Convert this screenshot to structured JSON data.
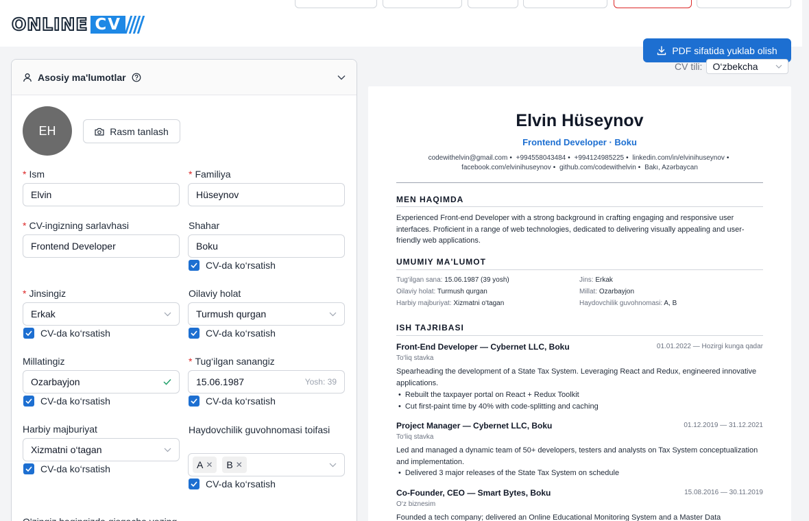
{
  "header": {
    "logo_left": "ONLINE",
    "logo_right": "CV"
  },
  "download_button": "PDF sifatida yuklab olish",
  "cv_language": {
    "label": "CV tili:",
    "value": "O‘zbekcha"
  },
  "form": {
    "section_title": "Asosiy ma'lumotlar",
    "avatar_initials": "EH",
    "photo_button": "Rasm tanlash",
    "show_in_cv": "CV-da ko‘rsatish",
    "first_name": {
      "label": "Ism",
      "value": "Elvin"
    },
    "last_name": {
      "label": "Familiya",
      "value": "Hüseynov"
    },
    "cv_title": {
      "label": "CV-ingizning sarlavhasi",
      "value": "Frontend Developer"
    },
    "city": {
      "label": "Shahar",
      "value": "Boku"
    },
    "gender": {
      "label": "Jinsingiz",
      "value": "Erkak"
    },
    "marital": {
      "label": "Oilaviy holat",
      "value": "Turmush qurgan"
    },
    "nationality": {
      "label": "Millatingiz",
      "value": "Ozarbayjon"
    },
    "birthdate": {
      "label": "Tug‘ilgan sanangiz",
      "value": "15.06.1987",
      "age": "Yosh: 39"
    },
    "military": {
      "label": "Harbiy majburiyat",
      "value": "Xizmatni o‘tagan"
    },
    "license": {
      "label": "Haydovchilik guvohnomasi toifasi",
      "tags": [
        "A",
        "B"
      ]
    },
    "bottom_text": "O'zingiz haqingizda qisqacha yozing"
  },
  "cv": {
    "name": "Elvin Hüseynov",
    "role_line": "Frontend Developer · Boku",
    "contacts": [
      "codewithelvin@gmail.com",
      "+994558043484",
      "+994124985225",
      "linkedin.com/in/elvinihuseynov",
      "facebook.com/elvinihuseynov",
      "github.com/codewithelvin",
      "Bakı, Azərbaycan"
    ],
    "about_title": "MEN HAQIMDA",
    "about_text": "Experienced Front-end Developer with a strong background in crafting engaging and responsive user interfaces. Proficient in a range of web technologies, dedicated to delivering visually appealing and user-friendly web applications.",
    "general_title": "UMUMIY MA'LUMOT",
    "general": [
      {
        "k": "Tug‘ilgan sana:",
        "v": "15.06.1987 (39 yosh)"
      },
      {
        "k": "Jins:",
        "v": "Erkak"
      },
      {
        "k": "Oilaviy holat:",
        "v": "Turmush qurgan"
      },
      {
        "k": "Millat:",
        "v": "Ozarbayjon"
      },
      {
        "k": "Harbiy majburiyat:",
        "v": "Xizmatni o‘tagan"
      },
      {
        "k": "Haydovchilik guvohnomasi:",
        "v": "A, B"
      }
    ],
    "experience_title": "ISH TAJRIBASI",
    "jobs": [
      {
        "title": "Front-End Developer — Cybernet LLC, Boku",
        "date": "01.01.2022 — Hozirgi kunga qadar",
        "type": "To‘liq stavka",
        "desc": "Spearheading the development of a State Tax System. Leveraging React and Redux, engineered innovative applications.",
        "bullets": [
          "Rebuilt the taxpayer portal on React + Redux Toolkit",
          "Cut first-paint time by 40% with code-splitting and caching"
        ]
      },
      {
        "title": "Project Manager — Cybernet LLC, Boku",
        "date": "01.12.2019 — 31.12.2021",
        "type": "To‘liq stavka",
        "desc": "Led and managed a dynamic team of 50+ developers, testers and analysts on Tax System conceptualization and implementation.",
        "bullets": [
          "Delivered 3 major releases of the State Tax System on schedule"
        ]
      },
      {
        "title": "Co-Founder, CEO — Smart Bytes, Boku",
        "date": "15.08.2016 — 30.11.2019",
        "type": "O‘z biznesim",
        "desc": "Founded a tech company; delivered an Online Educational Monitoring System and a Master Data"
      }
    ]
  }
}
